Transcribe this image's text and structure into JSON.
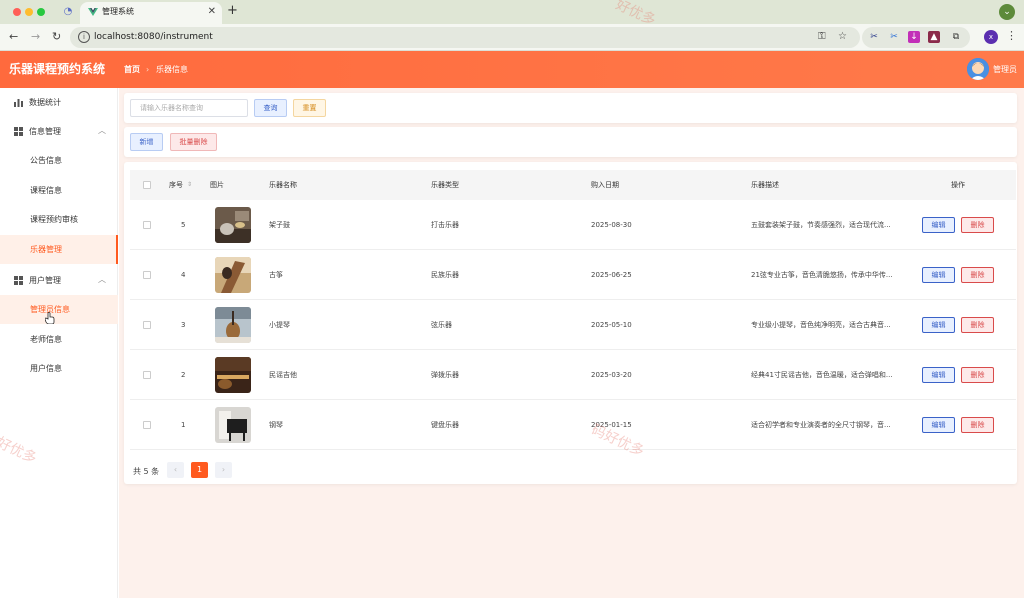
{
  "browser": {
    "tab_title": "管理系统",
    "url": "localhost:8080/instrument",
    "profile_initial": "x"
  },
  "app": {
    "title": "乐器课程预约系统",
    "breadcrumb_home": "首页",
    "breadcrumb_current": "乐器信息",
    "user_name": "管理员"
  },
  "sidebar": {
    "items": [
      {
        "label": "数据统计",
        "icon": "bar-chart-icon"
      },
      {
        "label": "信息管理",
        "icon": "grid-icon"
      },
      {
        "label": "公告信息"
      },
      {
        "label": "课程信息"
      },
      {
        "label": "课程预约审核"
      },
      {
        "label": "乐器管理"
      },
      {
        "label": "用户管理",
        "icon": "grid-icon"
      },
      {
        "label": "管理员信息"
      },
      {
        "label": "老师信息"
      },
      {
        "label": "用户信息"
      }
    ]
  },
  "search": {
    "placeholder": "请输入乐器名称查询",
    "query_label": "查询",
    "reset_label": "重置"
  },
  "toolbar": {
    "add_label": "新增",
    "batch_delete_label": "批量删除"
  },
  "table": {
    "headers": [
      "序号",
      "图片",
      "乐器名称",
      "乐器类型",
      "购入日期",
      "乐器描述",
      "操作"
    ],
    "edit_label": "编辑",
    "delete_label": "删除",
    "rows": [
      {
        "id": "5",
        "name": "架子鼓",
        "type": "打击乐器",
        "date": "2025-08-30",
        "desc": "五鼓套装架子鼓，节奏感强烈，适合现代流..."
      },
      {
        "id": "4",
        "name": "古筝",
        "type": "民族乐器",
        "date": "2025-06-25",
        "desc": "21弦专业古筝，音色清脆悠扬，传承中华传..."
      },
      {
        "id": "3",
        "name": "小提琴",
        "type": "弦乐器",
        "date": "2025-05-10",
        "desc": "专业级小提琴，音色纯净明亮，适合古典音..."
      },
      {
        "id": "2",
        "name": "民谣吉他",
        "type": "弹拨乐器",
        "date": "2025-03-20",
        "desc": "经典41寸民谣吉他，音色温暖，适合弹唱和..."
      },
      {
        "id": "1",
        "name": "钢琴",
        "type": "键盘乐器",
        "date": "2025-01-15",
        "desc": "适合初学者和专业演奏者的全尺寸钢琴，音..."
      }
    ]
  },
  "pagination": {
    "total": "共 5 条",
    "prev": "‹",
    "current_page": "1",
    "next": "›"
  },
  "colors": {
    "accent": "#ff5a1f",
    "header": "#ff6a3d"
  }
}
